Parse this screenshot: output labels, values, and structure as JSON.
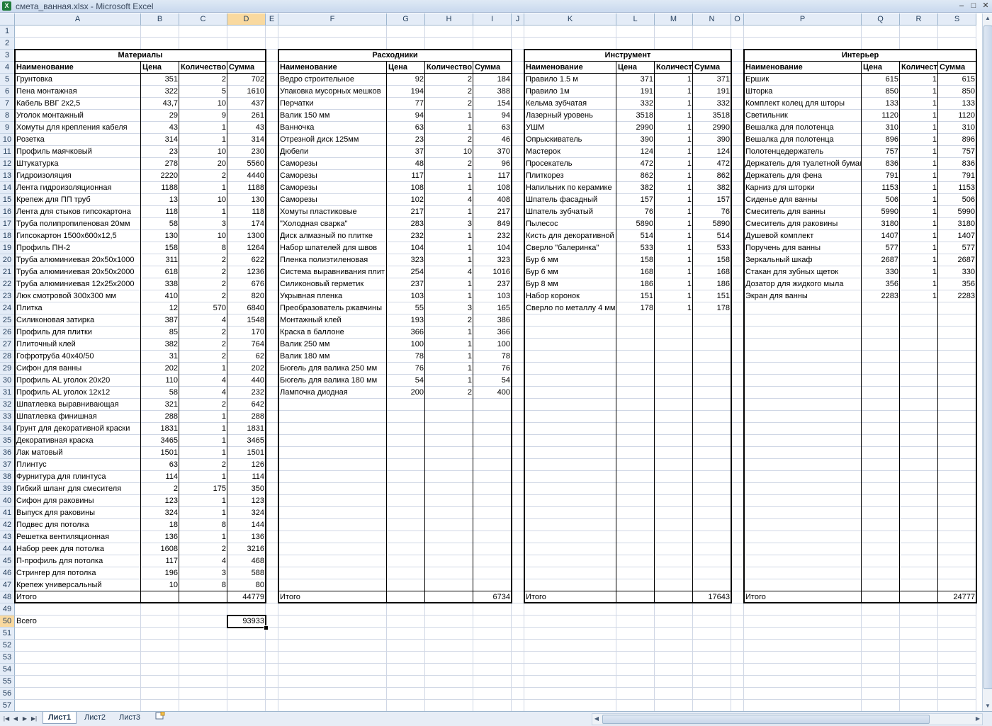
{
  "window": {
    "title": "смета_ванная.xlsx - Microsoft Excel",
    "app_icon": "X"
  },
  "columns": [
    "A",
    "B",
    "C",
    "D",
    "E",
    "F",
    "G",
    "H",
    "I",
    "J",
    "K",
    "L",
    "M",
    "N",
    "O",
    "P",
    "Q",
    "R",
    "S"
  ],
  "row_numbers": [
    "1",
    "2",
    "3",
    "4",
    "5",
    "6",
    "7",
    "8",
    "9",
    "10",
    "11",
    "12",
    "13",
    "14",
    "15",
    "16",
    "17",
    "18",
    "19",
    "20",
    "21",
    "22",
    "23",
    "24",
    "25",
    "26",
    "27",
    "28",
    "29",
    "30",
    "31",
    "32",
    "33",
    "34",
    "35",
    "36",
    "37",
    "38",
    "39",
    "40",
    "41",
    "42",
    "43",
    "44",
    "45",
    "46",
    "47",
    "48",
    "49",
    "50",
    "51",
    "52",
    "53",
    "54",
    "55",
    "56",
    "57"
  ],
  "selected": {
    "cell": "D50",
    "column": "D",
    "row": "50"
  },
  "headers": {
    "name": "Наименование",
    "price": "Цена",
    "qty": "Количество",
    "sum": "Сумма",
    "total": "Итого"
  },
  "tables": [
    {
      "title": "Материалы",
      "items": [
        [
          "Грунтовка",
          "351",
          "2",
          "702"
        ],
        [
          "Пена монтажная",
          "322",
          "5",
          "1610"
        ],
        [
          "Кабель ВВГ 2х2,5",
          "43,7",
          "10",
          "437"
        ],
        [
          "Уголок монтажный",
          "29",
          "9",
          "261"
        ],
        [
          "Хомуты для крепления кабеля",
          "43",
          "1",
          "43"
        ],
        [
          "Розетка",
          "314",
          "1",
          "314"
        ],
        [
          "Профиль маячковый",
          "23",
          "10",
          "230"
        ],
        [
          "Штукатурка",
          "278",
          "20",
          "5560"
        ],
        [
          "Гидроизоляция",
          "2220",
          "2",
          "4440"
        ],
        [
          "Лента гидроизоляционная",
          "1188",
          "1",
          "1188"
        ],
        [
          "Крепеж для ПП труб",
          "13",
          "10",
          "130"
        ],
        [
          "Лента для стыков гипсокартона",
          "118",
          "1",
          "118"
        ],
        [
          "Труба полипропиленовая 20мм",
          "58",
          "3",
          "174"
        ],
        [
          "Гипсокартон 1500х600х12,5",
          "130",
          "10",
          "1300"
        ],
        [
          "Профиль ПН-2",
          "158",
          "8",
          "1264"
        ],
        [
          "Труба алюминиевая 20х50х1000",
          "311",
          "2",
          "622"
        ],
        [
          "Труба алюминиевая 20х50х2000",
          "618",
          "2",
          "1236"
        ],
        [
          "Труба алюминиевая 12х25х2000",
          "338",
          "2",
          "676"
        ],
        [
          "Люк смотровой 300х300 мм",
          "410",
          "2",
          "820"
        ],
        [
          "Плитка",
          "12",
          "570",
          "6840"
        ],
        [
          "Силиконовая затирка",
          "387",
          "4",
          "1548"
        ],
        [
          "Профиль для плитки",
          "85",
          "2",
          "170"
        ],
        [
          "Плиточный клей",
          "382",
          "2",
          "764"
        ],
        [
          "Гофротруба 40х40/50",
          "31",
          "2",
          "62"
        ],
        [
          "Сифон для ванны",
          "202",
          "1",
          "202"
        ],
        [
          "Профиль AL уголок 20х20",
          "110",
          "4",
          "440"
        ],
        [
          "Профиль AL уголок 12х12",
          "58",
          "4",
          "232"
        ],
        [
          "Шпатлевка выравнивающая",
          "321",
          "2",
          "642"
        ],
        [
          "Шпатлевка финишная",
          "288",
          "1",
          "288"
        ],
        [
          "Грунт для декоративной краски",
          "1831",
          "1",
          "1831"
        ],
        [
          "Декоративная краска",
          "3465",
          "1",
          "3465"
        ],
        [
          "Лак матовый",
          "1501",
          "1",
          "1501"
        ],
        [
          "Плинтус",
          "63",
          "2",
          "126"
        ],
        [
          "Фурнитура для плинтуса",
          "114",
          "1",
          "114"
        ],
        [
          "Гибкий шланг для смесителя",
          "2",
          "175",
          "350"
        ],
        [
          "Сифон для раковины",
          "123",
          "1",
          "123"
        ],
        [
          "Выпуск для раковины",
          "324",
          "1",
          "324"
        ],
        [
          "Подвес для потолка",
          "18",
          "8",
          "144"
        ],
        [
          "Решетка вентиляционная",
          "136",
          "1",
          "136"
        ],
        [
          "Набор реек для потолка",
          "1608",
          "2",
          "3216"
        ],
        [
          "П-профиль для потолка",
          "117",
          "4",
          "468"
        ],
        [
          "Стрингер для потолка",
          "196",
          "3",
          "588"
        ],
        [
          "Крепеж универсальный",
          "10",
          "8",
          "80"
        ]
      ],
      "total": "44779"
    },
    {
      "title": "Расходники",
      "items": [
        [
          "Ведро строительное",
          "92",
          "2",
          "184"
        ],
        [
          "Упаковка мусорных мешков",
          "194",
          "2",
          "388"
        ],
        [
          "Перчатки",
          "77",
          "2",
          "154"
        ],
        [
          "Валик 150 мм",
          "94",
          "1",
          "94"
        ],
        [
          "Ванночка",
          "63",
          "1",
          "63"
        ],
        [
          "Отрезной диск 125мм",
          "23",
          "2",
          "46"
        ],
        [
          "Дюбели",
          "37",
          "10",
          "370"
        ],
        [
          "Саморезы",
          "48",
          "2",
          "96"
        ],
        [
          "Саморезы",
          "117",
          "1",
          "117"
        ],
        [
          "Саморезы",
          "108",
          "1",
          "108"
        ],
        [
          "Саморезы",
          "102",
          "4",
          "408"
        ],
        [
          "Хомуты пластиковые",
          "217",
          "1",
          "217"
        ],
        [
          "\"Холодная сварка\"",
          "283",
          "3",
          "849"
        ],
        [
          "Диск алмазный по плитке",
          "232",
          "1",
          "232"
        ],
        [
          "Набор шпателей для швов",
          "104",
          "1",
          "104"
        ],
        [
          "Пленка полиэтиленовая",
          "323",
          "1",
          "323"
        ],
        [
          "Система выравнивания плит",
          "254",
          "4",
          "1016"
        ],
        [
          "Силиконовый герметик",
          "237",
          "1",
          "237"
        ],
        [
          "Укрывная пленка",
          "103",
          "1",
          "103"
        ],
        [
          "Преобразователь ржавчины",
          "55",
          "3",
          "165"
        ],
        [
          "Монтажный клей",
          "193",
          "2",
          "386"
        ],
        [
          "Краска в баллоне",
          "366",
          "1",
          "366"
        ],
        [
          "Валик 250 мм",
          "100",
          "1",
          "100"
        ],
        [
          "Валик 180 мм",
          "78",
          "1",
          "78"
        ],
        [
          "Бюгель для валика 250 мм",
          "76",
          "1",
          "76"
        ],
        [
          "Бюгель для валика 180 мм",
          "54",
          "1",
          "54"
        ],
        [
          "Лампочка диодная",
          "200",
          "2",
          "400"
        ]
      ],
      "total": "6734"
    },
    {
      "title": "Инструмент",
      "items": [
        [
          "Правило 1.5 м",
          "371",
          "1",
          "371"
        ],
        [
          "Правило 1м",
          "191",
          "1",
          "191"
        ],
        [
          "Кельма зубчатая",
          "332",
          "1",
          "332"
        ],
        [
          "Лазерный уровень",
          "3518",
          "1",
          "3518"
        ],
        [
          "УШМ",
          "2990",
          "1",
          "2990"
        ],
        [
          "Опрыскиватель",
          "390",
          "1",
          "390"
        ],
        [
          "Мастерок",
          "124",
          "1",
          "124"
        ],
        [
          "Просекатель",
          "472",
          "1",
          "472"
        ],
        [
          "Плиткорез",
          "862",
          "1",
          "862"
        ],
        [
          "Напильник по керамике",
          "382",
          "1",
          "382"
        ],
        [
          "Шпатель фасадный",
          "157",
          "1",
          "157"
        ],
        [
          "Шпатель зубчатый",
          "76",
          "1",
          "76"
        ],
        [
          "Пылесос",
          "5890",
          "1",
          "5890"
        ],
        [
          "Кисть для декоративной",
          "514",
          "1",
          "514"
        ],
        [
          "Сверло \"балеринка\"",
          "533",
          "1",
          "533"
        ],
        [
          "Бур 6 мм",
          "158",
          "1",
          "158"
        ],
        [
          "Бур 6 мм",
          "168",
          "1",
          "168"
        ],
        [
          "Бур 8 мм",
          "186",
          "1",
          "186"
        ],
        [
          "Набор коронок",
          "151",
          "1",
          "151"
        ],
        [
          "Сверло по металлу 4 мм",
          "178",
          "1",
          "178"
        ]
      ],
      "total": "17643"
    },
    {
      "title": "Интерьер",
      "items": [
        [
          "Ершик",
          "615",
          "1",
          "615"
        ],
        [
          "Шторка",
          "850",
          "1",
          "850"
        ],
        [
          "Комплект колец для шторы",
          "133",
          "1",
          "133"
        ],
        [
          "Светильник",
          "1120",
          "1",
          "1120"
        ],
        [
          "Вешалка для полотенца",
          "310",
          "1",
          "310"
        ],
        [
          "Вешалка для полотенца",
          "896",
          "1",
          "896"
        ],
        [
          "Полотенцедержатель",
          "757",
          "1",
          "757"
        ],
        [
          "Держатель для туалетной бумаги",
          "836",
          "1",
          "836"
        ],
        [
          "Держатель для фена",
          "791",
          "1",
          "791"
        ],
        [
          "Карниз для шторки",
          "1153",
          "1",
          "1153"
        ],
        [
          "Сиденье для ванны",
          "506",
          "1",
          "506"
        ],
        [
          "Смеситель для ванны",
          "5990",
          "1",
          "5990"
        ],
        [
          "Смеситель для раковины",
          "3180",
          "1",
          "3180"
        ],
        [
          "Душевой комплект",
          "1407",
          "1",
          "1407"
        ],
        [
          "Поручень для ванны",
          "577",
          "1",
          "577"
        ],
        [
          "Зеркальный шкаф",
          "2687",
          "1",
          "2687"
        ],
        [
          "Стакан для зубных щеток",
          "330",
          "1",
          "330"
        ],
        [
          "Дозатор для жидкого мыла",
          "356",
          "1",
          "356"
        ],
        [
          "Экран для ванны",
          "2283",
          "1",
          "2283"
        ]
      ],
      "total": "24777"
    }
  ],
  "grand_total": {
    "label": "Всего",
    "value": "93933"
  },
  "sheet_tabs": [
    "Лист1",
    "Лист2",
    "Лист3"
  ],
  "active_sheet": "Лист1"
}
